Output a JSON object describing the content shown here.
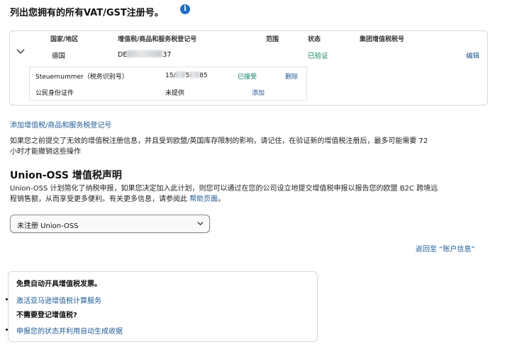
{
  "header": {
    "title": "列出您拥有的所有VAT/GST注册号。",
    "info_icon": "info-icon"
  },
  "vat_table": {
    "columns": [
      "国家/地区",
      "增值税/商品和服务税登记号",
      "范围",
      "状态",
      "集团增值税税号"
    ],
    "rows": [
      {
        "country": "德国",
        "vat_prefix": "DE",
        "vat_suffix": "37",
        "scope": "",
        "status": "已验证",
        "group_vat": "",
        "action": "编辑"
      }
    ],
    "sub_rows": [
      {
        "label": "Steuernummer（税务识别号）",
        "value_prefix": "15/",
        "value_mid": "5",
        "value_suffix": "85",
        "status": "已接受",
        "action": "删除"
      },
      {
        "label": "公民身份证件",
        "value": "未提供",
        "status": "",
        "action": "添加"
      }
    ]
  },
  "add_vat_link": "添加增值税/商品和服务税登记号",
  "notice_line1": "如果您之前提交了无效的增值税注册信息，并且受到欧盟/英国库存限制的影响，请记住，在验证新的增值税注册后，最多可能需要 72",
  "notice_line2": "小时才能撤销这些操作",
  "oss": {
    "heading": "Union-OSS 增值税声明",
    "desc_line1": "Union-OSS 计划简化了纳税申报，如果您决定加入此计划，则您可以通过在您的公司设立地提交增值税申报以报告您的欧盟 B2C 跨境远",
    "desc_line2_prefix": "程销售额，从而享受更多便利。有关更多信息，请参阅此",
    "desc_link": "帮助页面",
    "desc_line2_suffix": "。",
    "select_value": "未注册 Union-OSS"
  },
  "back_link": "返回至 “账户信息”",
  "promo": {
    "title": "免费自动开具增值税发票。",
    "link1": "激活亚马逊增值税计算服务",
    "subtitle": "不需要登记增值税?",
    "link2": "申报您的状态并利用自动生成收据"
  },
  "colors": {
    "link": "#1f5a96",
    "verified": "#067d62",
    "info": "#1f6fc6"
  }
}
